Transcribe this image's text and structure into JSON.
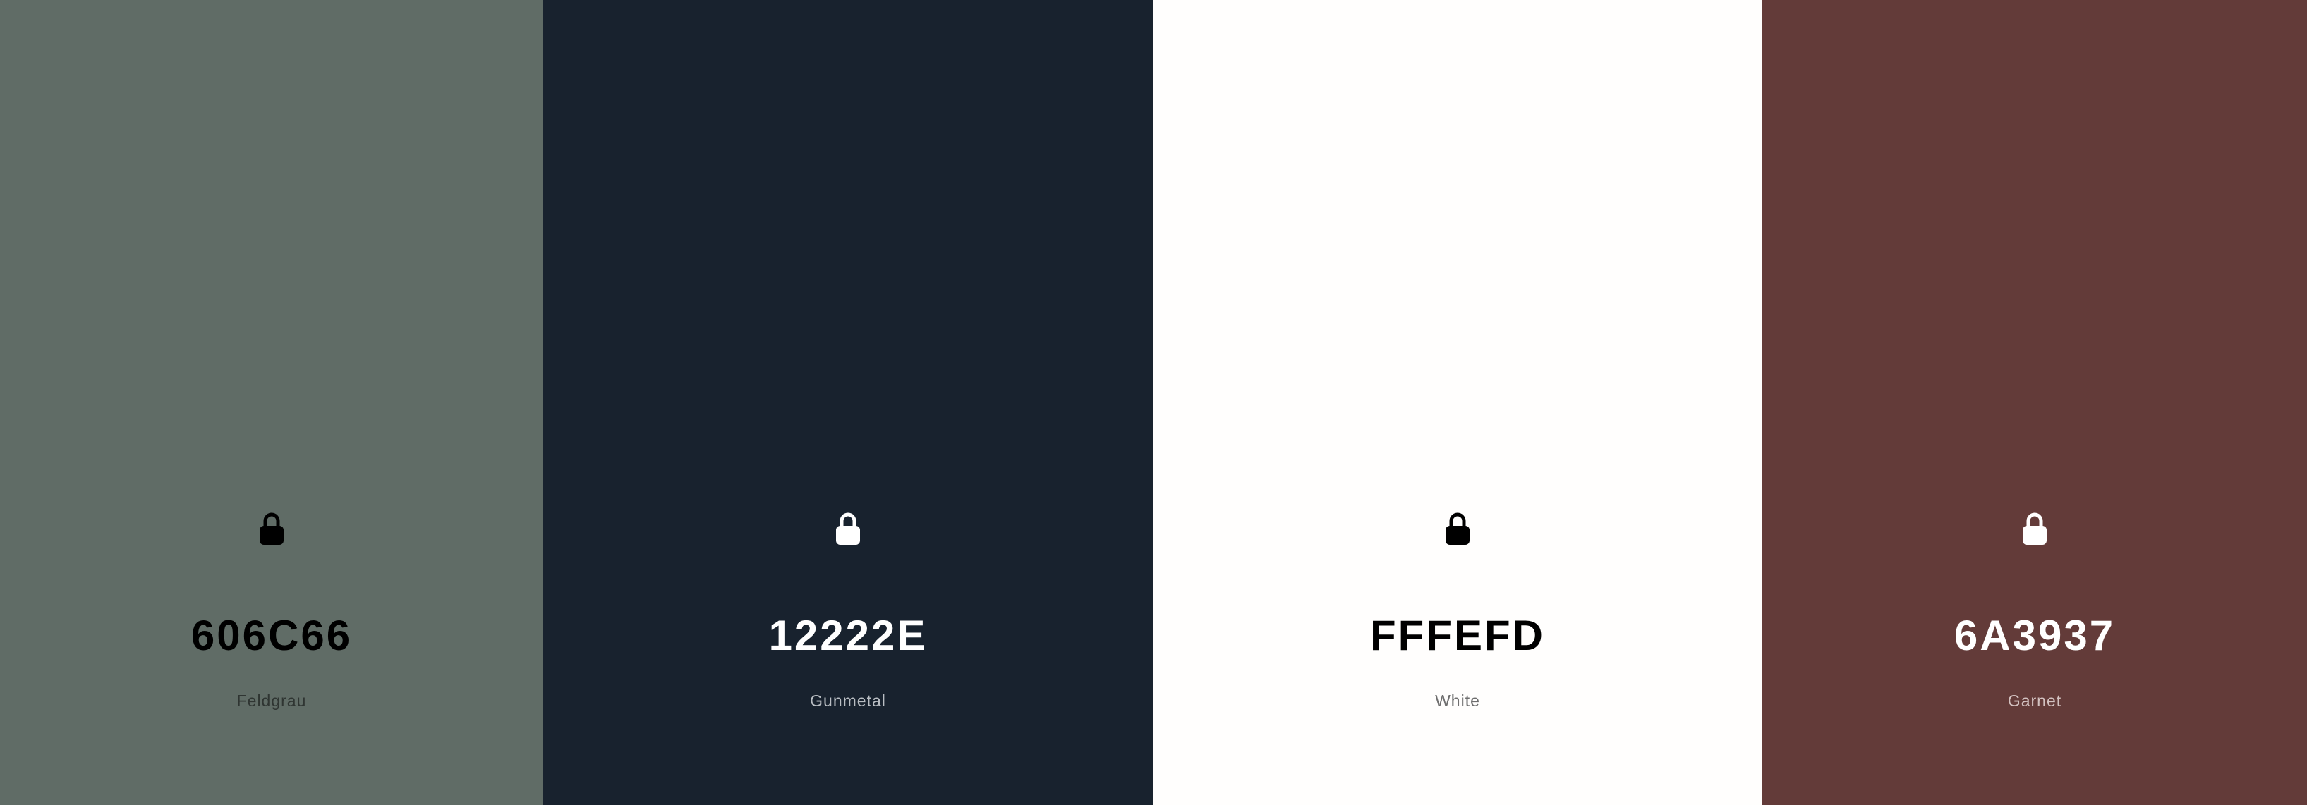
{
  "palette": {
    "swatches": [
      {
        "hex": "606C66",
        "name": "Feldgrau",
        "background": "#606C66",
        "text_color": "#000000",
        "name_color": "#2F3532",
        "lock_color": "#000000",
        "icon": "lock-icon"
      },
      {
        "hex": "12222E",
        "name": "Gunmetal",
        "background": "#18222E",
        "text_color": "#FFFFFF",
        "name_color": "#B9BEC3",
        "lock_color": "#FFFFFF",
        "icon": "lock-icon"
      },
      {
        "hex": "FFFEFD",
        "name": "White",
        "background": "#FFFEFD",
        "text_color": "#000000",
        "name_color": "#6E6E6E",
        "lock_color": "#000000",
        "icon": "lock-icon"
      },
      {
        "hex": "6A3937",
        "name": "Garnet",
        "background": "#633B39",
        "text_color": "#FFFFFF",
        "name_color": "#D3C2C1",
        "lock_color": "#FFFFFF",
        "icon": "lock-icon"
      }
    ]
  }
}
